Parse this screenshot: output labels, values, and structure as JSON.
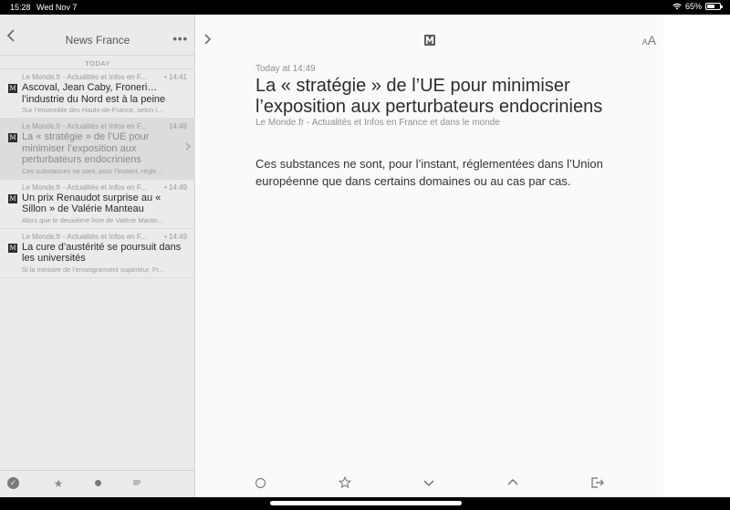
{
  "status": {
    "time": "15:28",
    "date": "Wed Nov 7",
    "battery": "65%",
    "battery_level": 0.65
  },
  "sidebar": {
    "title": "News France",
    "more_label": "•••",
    "section": "TODAY",
    "articles": [
      {
        "source": "Le Monde.fr - Actualités et Infos en F...",
        "time": "• 14:41",
        "title": "Ascoval, Jean Caby, Froneri… l’industrie du Nord est à la peine",
        "excerpt": "Sur l’ensemble des Hauts-de-France, selon l...",
        "selected": false
      },
      {
        "source": "Le Monde.fr - Actualités et Infos en F...",
        "time": "14:49",
        "title": "La « stratégie » de l’UE pour minimiser l’exposition aux perturbateurs endocriniens",
        "excerpt": "Ces substances ne sont, pour l’instant, régle...",
        "selected": true
      },
      {
        "source": "Le Monde.fr - Actualités et Infos en F...",
        "time": "• 14:49",
        "title": "Un prix Renaudot surprise au « Sillon » de Valérie Manteau",
        "excerpt": "Alors que le deuxième livre de Valérie Mante...",
        "selected": false
      },
      {
        "source": "Le Monde.fr - Actualités et Infos en F...",
        "time": "• 14:49",
        "title": "La cure d’austérité se poursuit dans les universités",
        "excerpt": "Si la ministre de l’enseignement supérieur, Fr...",
        "selected": false
      }
    ]
  },
  "reader": {
    "date": "Today at 14:49",
    "title": "La « stratégie » de l’UE pour minimiser l’exposition aux perturbateurs endocriniens",
    "source": "Le Monde.fr - Actualités et Infos en France et dans le monde",
    "body": "Ces substances ne sont, pour l’instant, réglementées dans l’Union européenne que dans certains domaines ou au cas par cas."
  },
  "icons": {
    "favicon": "M",
    "aa_small": "A",
    "aa_big": "A"
  }
}
